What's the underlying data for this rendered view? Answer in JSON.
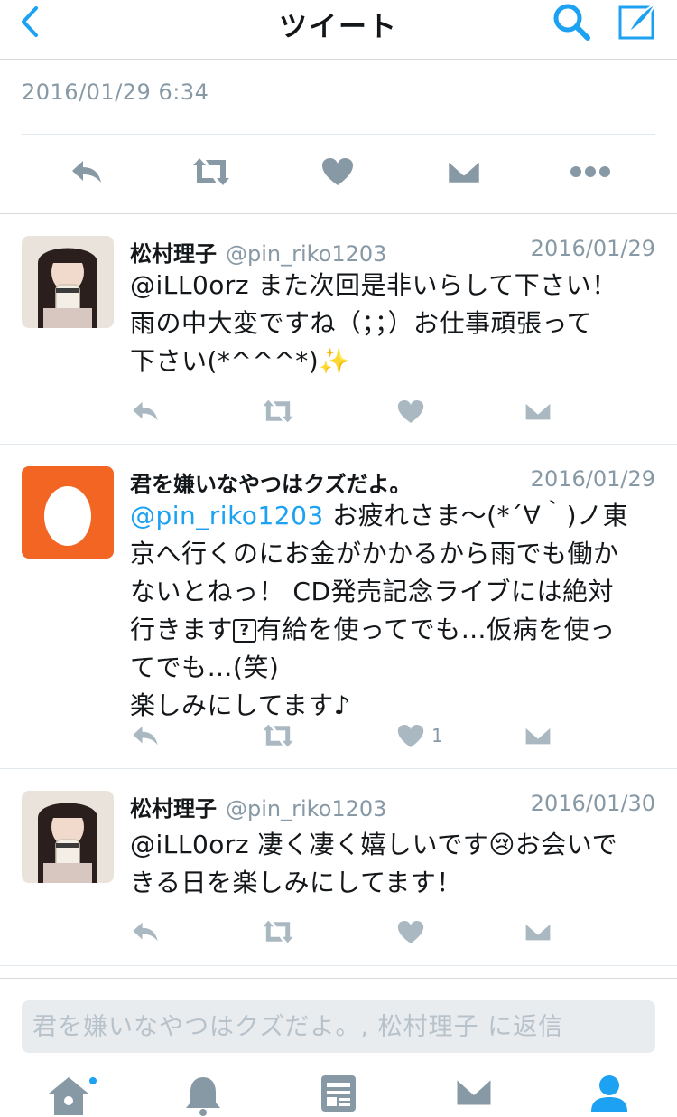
{
  "header": {
    "title": "ツイート"
  },
  "main_tweet": {
    "timestamp": "2016/01/29 6:34"
  },
  "replies": [
    {
      "name": "松村理子",
      "handle": "@pin_riko1203",
      "date": "2016/01/29",
      "mention": "@iLL0orz",
      "text": " また次回是非いらして下さい！\n雨の中大変ですね（；；）お仕事頑張って\n下さい(*^^^*)✨"
    },
    {
      "name": "君を嫌いなやつはクズだよ。",
      "handle": "",
      "date": "2016/01/29",
      "mention": "@pin_riko1203",
      "text_1": " お疲れさま〜(*´∀｀)ノ東\n京へ行くのにお金がかかるから雨でも働か\nないとねっ！ CD発売記念ライブには絶対\n行きます",
      "emoji_glyph": "?",
      "text_2": "有給を使ってでも…仮病を使っ\nてでも…(笑)\n楽しみにしてます♪",
      "like_count": "1"
    },
    {
      "name": "松村理子",
      "handle": "@pin_riko1203",
      "date": "2016/01/30",
      "mention": "@iLL0orz",
      "text_1": " 凄く凄く嬉しいです",
      "emoji": "😢",
      "text_2": "お会いで\nきる日を楽しみにしてます！"
    }
  ],
  "composer": {
    "placeholder": "君を嫌いなやつはクズだよ。, 松村理子 に返信"
  },
  "tabs": [
    "home",
    "notifications",
    "moments",
    "messages",
    "me"
  ],
  "colors": {
    "accent": "#1da1f2",
    "icon_gray": "#8899a6",
    "action_gray": "#aab8c2",
    "egg_orange": "#f26522"
  }
}
